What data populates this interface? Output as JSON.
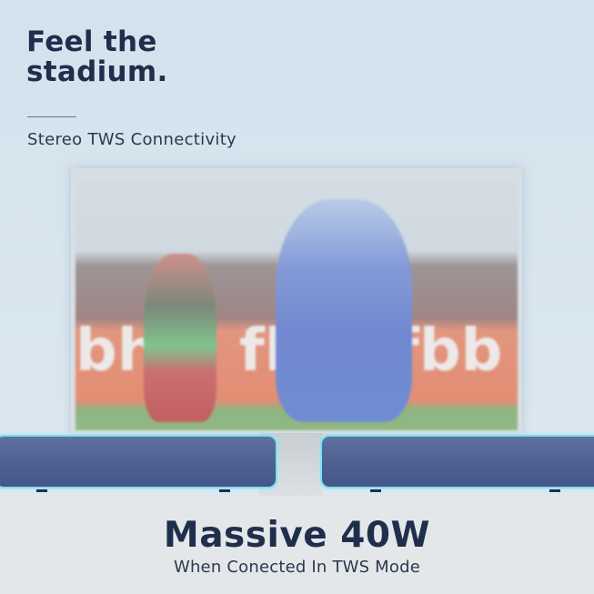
{
  "headline": "Feel the\nstadium.",
  "headline_line1": "Feel the",
  "headline_line2": "stadium.",
  "subheading": "Stereo TWS Connectivity",
  "tv_banner_text": "fbb",
  "power_title": "Massive 40W",
  "power_caption": "When Conected In TWS Mode",
  "colors": {
    "text_dark": "#1f2f4b",
    "soundbar": "#4f6190",
    "soundbar_glow": "#7fe0f0",
    "banner": "#e4683f"
  }
}
